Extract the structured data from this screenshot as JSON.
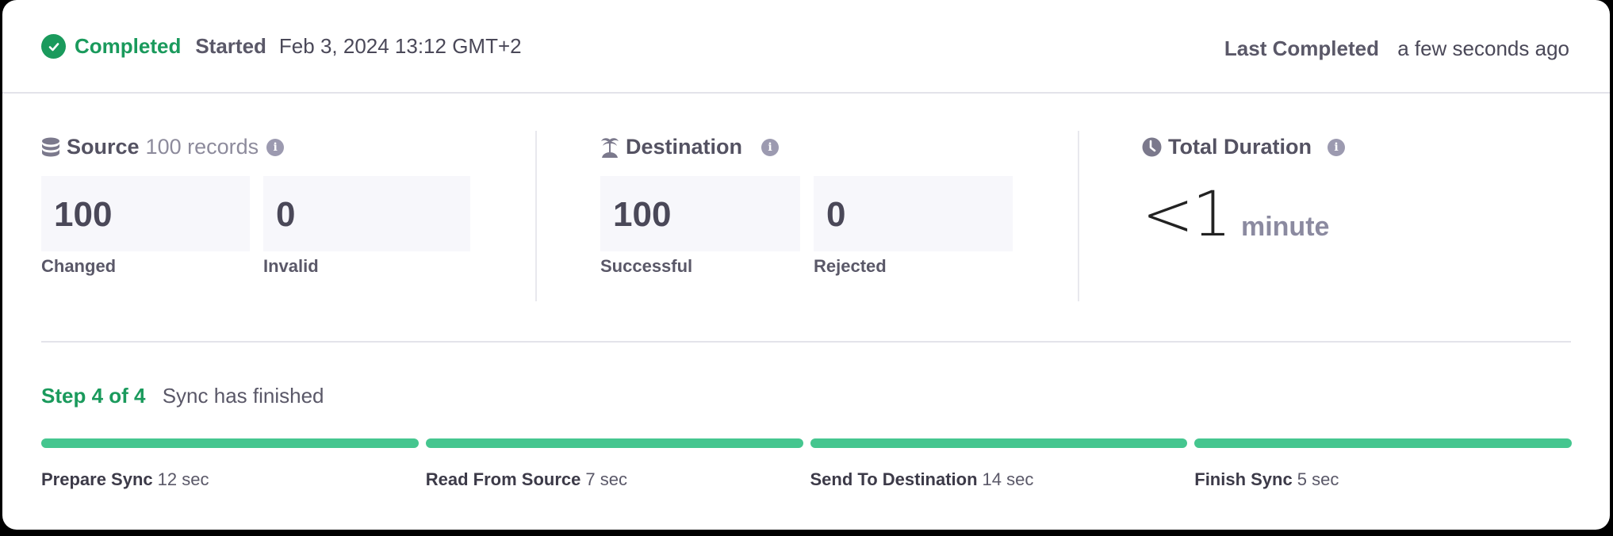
{
  "header": {
    "status": "Completed",
    "started_label": "Started",
    "started_value": "Feb 3, 2024 13:12 GMT+2",
    "last_completed_label": "Last Completed",
    "last_completed_value": "a few seconds ago",
    "status_color": "#1a9a5c"
  },
  "source": {
    "title": "Source",
    "subtitle": "100 records",
    "icon": "database-icon",
    "stats": [
      {
        "value": "100",
        "label": "Changed"
      },
      {
        "value": "0",
        "label": "Invalid"
      }
    ]
  },
  "destination": {
    "title": "Destination",
    "icon": "island-icon",
    "stats": [
      {
        "value": "100",
        "label": "Successful"
      },
      {
        "value": "0",
        "label": "Rejected"
      }
    ]
  },
  "duration": {
    "title": "Total Duration",
    "icon": "clock-icon",
    "value": "<1",
    "unit": "minute"
  },
  "info_glyph": "i",
  "progress": {
    "step_label": "Step 4 of 4",
    "description": "Sync has finished",
    "bar_color": "#45c68f",
    "steps": [
      {
        "name": "Prepare Sync",
        "duration": "12 sec",
        "complete": 1.0
      },
      {
        "name": "Read From Source",
        "duration": "7 sec",
        "complete": 1.0
      },
      {
        "name": "Send To Destination",
        "duration": "14 sec",
        "complete": 1.0
      },
      {
        "name": "Finish Sync",
        "duration": "5 sec",
        "complete": 1.0
      }
    ]
  }
}
